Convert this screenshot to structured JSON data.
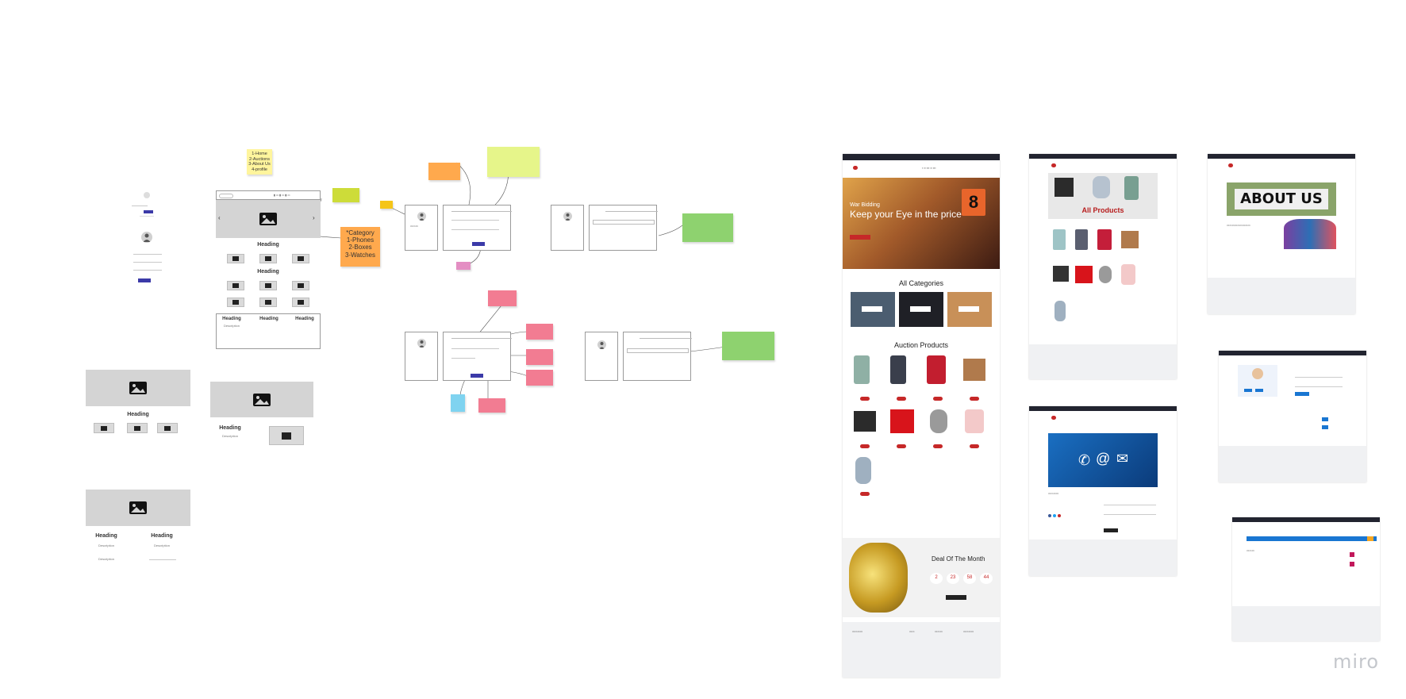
{
  "nav_sticky": {
    "lines": [
      "1-Home",
      "2-Auctions",
      "3-About Us",
      "4-profile"
    ]
  },
  "category_sticky": {
    "lines": [
      "*Category",
      "1-Phones",
      "2-Boxes",
      "3-Watches"
    ]
  },
  "wireframe": {
    "heading": "Heading",
    "description": "Description"
  },
  "mockup_home": {
    "hero_small": "War Bidding",
    "hero_title": "Keep your Eye in the price",
    "categories_title": "All Categories",
    "auction_title": "Auction Products",
    "deal_title": "Deal Of The Month",
    "deal_numbers": [
      "2",
      "23",
      "58",
      "44"
    ]
  },
  "mockup_products": {
    "banner_title": "All Products"
  },
  "mockup_about": {
    "banner_title": "ABOUT US"
  },
  "watermark": "miro",
  "colors": {
    "accent_red": "#c62828",
    "wire_blue": "#3b3aa8",
    "sticky_yellow": "#fff59d",
    "sticky_orange": "#ffa94d",
    "sticky_green": "#8ed26f",
    "sticky_pink": "#f27c92"
  }
}
